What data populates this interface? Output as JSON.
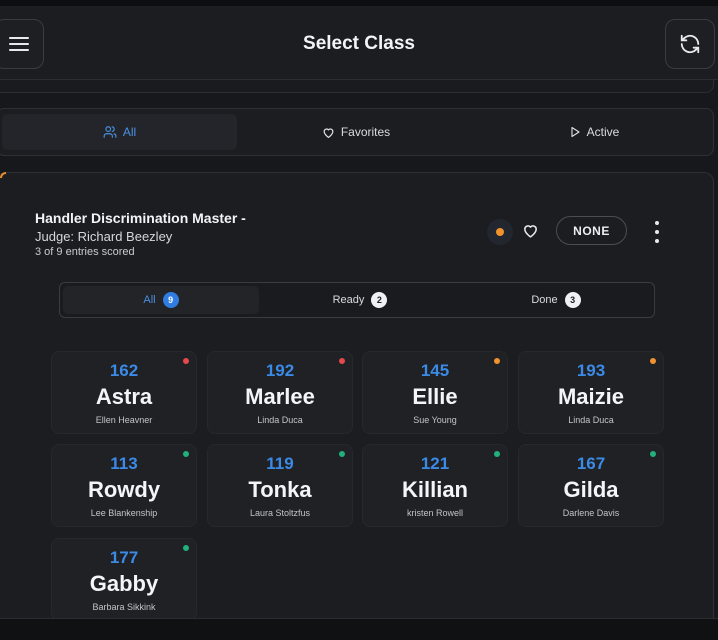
{
  "header": {
    "title": "Select Class",
    "menu_icon": "hamburger-menu-icon",
    "refresh_icon": "refresh-icon"
  },
  "filters": [
    {
      "label": "All",
      "icon": "users-icon",
      "active": true
    },
    {
      "label": "Favorites",
      "icon": "heart-icon",
      "active": false
    },
    {
      "label": "Active",
      "icon": "play-icon",
      "active": false
    }
  ],
  "class_card": {
    "title": "Handler Discrimination Master -",
    "judge": "Judge: Richard Beezley",
    "scored": "3 of 9 entries scored",
    "status_color": "#f0922e",
    "badge": "NONE",
    "tabs": [
      {
        "label": "All",
        "count": "9",
        "active": true
      },
      {
        "label": "Ready",
        "count": "2",
        "active": false
      },
      {
        "label": "Done",
        "count": "3",
        "active": false
      }
    ]
  },
  "entries": [
    {
      "number": "162",
      "name": "Astra",
      "handler": "Ellen Heavner",
      "status": "red"
    },
    {
      "number": "192",
      "name": "Marlee",
      "handler": "Linda Duca",
      "status": "red"
    },
    {
      "number": "145",
      "name": "Ellie",
      "handler": "Sue Young",
      "status": "orange"
    },
    {
      "number": "193",
      "name": "Maizie",
      "handler": "Linda Duca",
      "status": "orange"
    },
    {
      "number": "113",
      "name": "Rowdy",
      "handler": "Lee Blankenship",
      "status": "green"
    },
    {
      "number": "119",
      "name": "Tonka",
      "handler": "Laura Stoltzfus",
      "status": "green"
    },
    {
      "number": "121",
      "name": "Killian",
      "handler": "kristen Rowell",
      "status": "green"
    },
    {
      "number": "167",
      "name": "Gilda",
      "handler": "Darlene Davis",
      "status": "green"
    },
    {
      "number": "177",
      "name": "Gabby",
      "handler": "Barbara Sikkink",
      "status": "green"
    }
  ],
  "status_colors": {
    "red": "#e5484d",
    "orange": "#f0922e",
    "green": "#22b07d"
  }
}
